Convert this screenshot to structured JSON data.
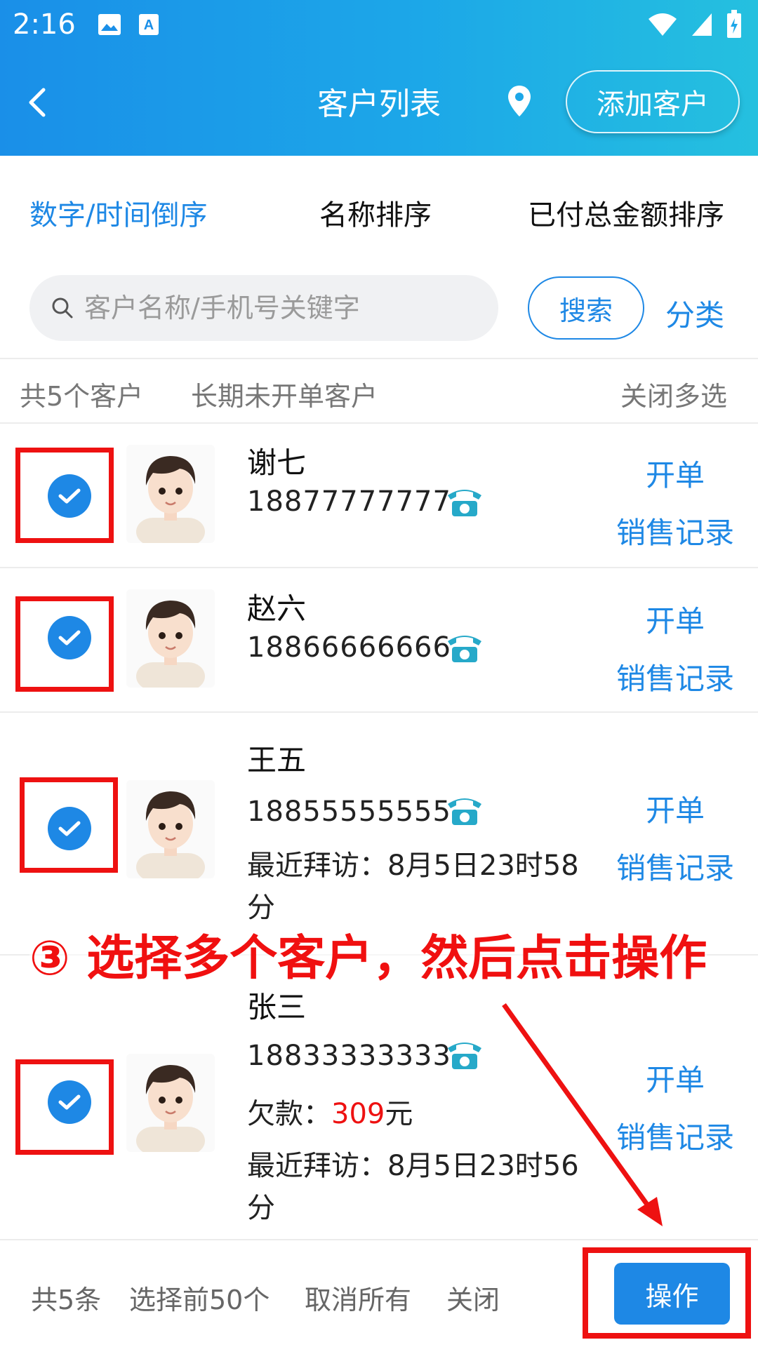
{
  "status_bar": {
    "time": "2:16"
  },
  "header": {
    "title": "客户列表",
    "add_button": "添加客户"
  },
  "sort_tabs": [
    {
      "label": "数字/时间倒序",
      "active": true
    },
    {
      "label": "名称排序",
      "active": false
    },
    {
      "label": "已付总金额排序",
      "active": false
    }
  ],
  "search": {
    "placeholder": "客户名称/手机号关键字",
    "button": "搜索",
    "category": "分类"
  },
  "meta": {
    "count": "共5个客户",
    "inactive": "长期未开单客户",
    "close_multi": "关闭多选"
  },
  "customers": [
    {
      "name": "谢七",
      "phone": "18877777777",
      "checked": true,
      "action_order": "开单",
      "action_sales": "销售记录"
    },
    {
      "name": "赵六",
      "phone": "18866666666",
      "checked": true,
      "action_order": "开单",
      "action_sales": "销售记录"
    },
    {
      "name": "王五",
      "phone": "18855555555",
      "last_visit": "最近拜访：8月5日23时58分",
      "checked": true,
      "action_order": "开单",
      "action_sales": "销售记录"
    },
    {
      "name": "张三",
      "phone": "18833333333",
      "debt_label": "欠款：",
      "debt_amount": "309",
      "debt_unit": "元",
      "last_visit": "最近拜访：8月5日23时56分",
      "checked": true,
      "action_order": "开单",
      "action_sales": "销售记录"
    }
  ],
  "instruction": "③ 选择多个客户，然后点击操作",
  "bottom_bar": {
    "total": "共5条",
    "select_first": "选择前50个",
    "cancel_all": "取消所有",
    "close": "关闭",
    "operate": "操作"
  },
  "colors": {
    "primary": "#1e88e5",
    "annotation_red": "#ee1111",
    "header_start": "#1a8fe8",
    "header_end": "#25c0df"
  }
}
